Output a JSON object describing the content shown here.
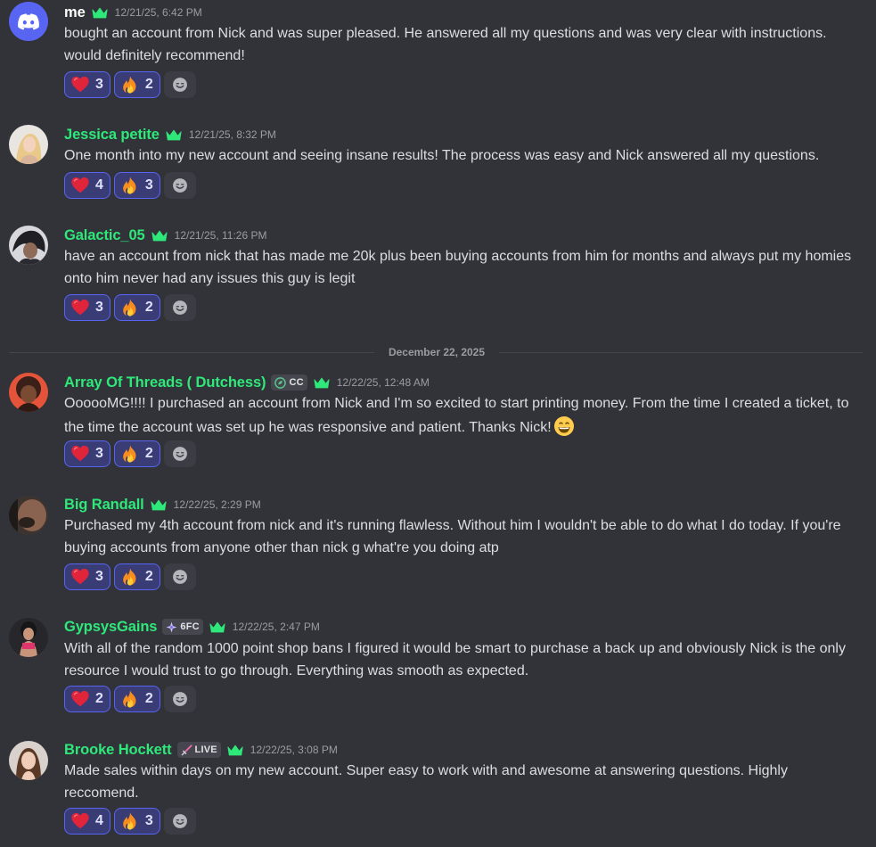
{
  "colors": {
    "background": "#323339",
    "username_white": "#ffffff",
    "username_green": "#2ee87a",
    "reaction_bg": "#393c75",
    "reaction_border": "#5865f2",
    "crown": "#2ee87a"
  },
  "date_divider": "December 22, 2025",
  "messages": [
    {
      "username": "me",
      "timestamp": "12/21/25, 6:42 PM",
      "text": "bought an account from Nick and was super pleased. He answered all my questions and was very clear with instructions. would definitely recommend!",
      "reactions": [
        {
          "emoji": "heart",
          "count": "3"
        },
        {
          "emoji": "fire",
          "count": "2"
        }
      ]
    },
    {
      "username": "Jessica petite",
      "timestamp": "12/21/25, 8:32 PM",
      "text": "One month into my new account and seeing insane results! The process was easy and Nick answered all my questions.",
      "reactions": [
        {
          "emoji": "heart",
          "count": "4"
        },
        {
          "emoji": "fire",
          "count": "3"
        }
      ]
    },
    {
      "username": "Galactic_05",
      "timestamp": "12/21/25, 11:26 PM",
      "text": "have an account from nick that has made me 20k plus been buying accounts from him for months and always put my homies onto him never had any issues this guy is legit",
      "reactions": [
        {
          "emoji": "heart",
          "count": "3"
        },
        {
          "emoji": "fire",
          "count": "2"
        }
      ]
    },
    {
      "username": "Array Of Threads ( Dutchess)",
      "tag": "CC",
      "tag_icon": "leaf-badge-icon",
      "timestamp": "12/22/25, 12:48 AM",
      "text": "OooooMG!!!! I purchased an account from Nick and I'm so excited to start printing money. From the time I created a ticket, to the time the account was set up he was responsive and patient. Thanks Nick!",
      "reactions": [
        {
          "emoji": "heart",
          "count": "3"
        },
        {
          "emoji": "fire",
          "count": "2"
        }
      ]
    },
    {
      "username": "Big Randall",
      "timestamp": "12/22/25, 2:29 PM",
      "text": "Purchased my 4th account from nick and it's running flawless. Without him I wouldn't be able to do what I do today. If you're buying accounts from anyone other than nick g what're you doing atp",
      "reactions": [
        {
          "emoji": "heart",
          "count": "3"
        },
        {
          "emoji": "fire",
          "count": "2"
        }
      ]
    },
    {
      "username": "GypsysGains",
      "tag": "6FC",
      "tag_icon": "sparkle-badge-icon",
      "timestamp": "12/22/25, 2:47 PM",
      "text": "With all of the random 1000 point shop bans I figured it would be smart to purchase a back up and obviously Nick is the only resource I would trust to go through. Everything was smooth as expected.",
      "reactions": [
        {
          "emoji": "heart",
          "count": "2"
        },
        {
          "emoji": "fire",
          "count": "2"
        }
      ]
    },
    {
      "username": "Brooke Hockett",
      "tag": "LIVE",
      "tag_icon": "sword-badge-icon",
      "timestamp": "12/22/25, 3:08 PM",
      "text": "Made sales within days on my new account. Super easy to work with and awesome at answering questions. Highly reccomend.",
      "reactions": [
        {
          "emoji": "heart",
          "count": "4"
        },
        {
          "emoji": "fire",
          "count": "3"
        }
      ]
    }
  ]
}
